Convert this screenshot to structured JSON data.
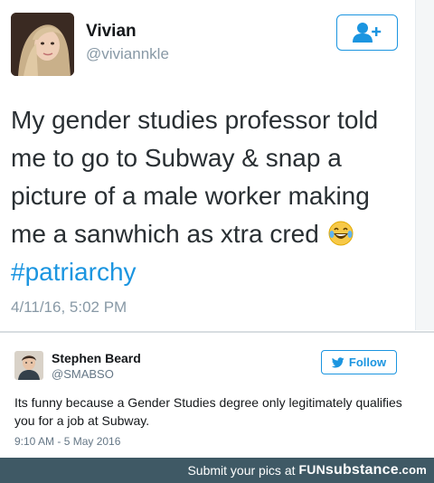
{
  "original_tweet": {
    "author_name": "Vivian",
    "author_handle": "@viviannkle",
    "text_line1": "My gender studies professor told",
    "text_line2": "me to go to Subway & snap a",
    "text_line3": "picture of a male worker making",
    "text_line4": "me a sanwhich as xtra cred",
    "hashtag": "#patriarchy",
    "timestamp": "4/11/16, 5:02 PM",
    "follow_icon": "add-user-icon",
    "emoji": "laughing-crying-emoji"
  },
  "reply_tweet": {
    "author_name": "Stephen Beard",
    "author_handle": "@SMABSO",
    "follow_label": "Follow",
    "text": "Its funny because a Gender Studies degree only legitimately qualifies you for a job at Subway.",
    "timestamp": "9:10 AM - 5 May 2016",
    "follow_icon": "bird-icon"
  },
  "footer": {
    "prefix": "Submit your pics at",
    "brand_fun": "FUN",
    "brand_substance": "substance",
    "brand_suffix": ".com"
  },
  "colors": {
    "accent": "#1b95e0",
    "footer_bg": "#3f5965",
    "muted": "#8899a6"
  }
}
